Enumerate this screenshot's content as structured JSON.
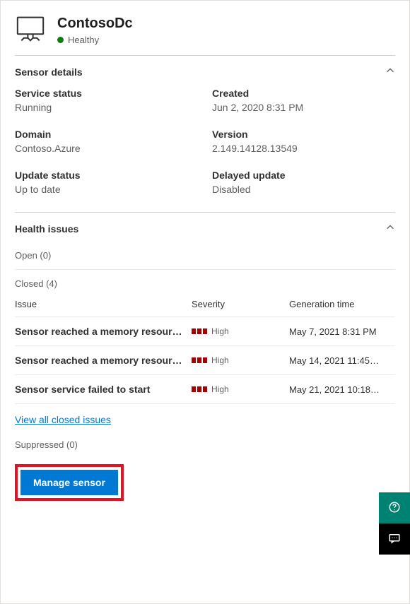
{
  "header": {
    "title": "ContosoDc",
    "status_text": "Healthy",
    "status_color": "#107c10"
  },
  "sections": {
    "sensor_details": {
      "title": "Sensor details",
      "fields": {
        "service_status": {
          "label": "Service status",
          "value": "Running"
        },
        "created": {
          "label": "Created",
          "value": "Jun 2, 2020 8:31 PM"
        },
        "domain": {
          "label": "Domain",
          "value": "Contoso.Azure"
        },
        "version": {
          "label": "Version",
          "value": "2.149.14128.13549"
        },
        "update_status": {
          "label": "Update status",
          "value": "Up to date"
        },
        "delayed_update": {
          "label": "Delayed update",
          "value": "Disabled"
        }
      }
    },
    "health_issues": {
      "title": "Health issues",
      "open_label": "Open (0)",
      "closed_label": "Closed (4)",
      "columns": {
        "issue": "Issue",
        "severity": "Severity",
        "generation_time": "Generation time"
      },
      "closed_rows": [
        {
          "issue": "Sensor reached a memory resource limit",
          "severity": "High",
          "time": "May 7, 2021 8:31 PM"
        },
        {
          "issue": "Sensor reached a memory resource limit",
          "severity": "High",
          "time": "May 14, 2021 11:45…"
        },
        {
          "issue": "Sensor service failed to start",
          "severity": "High",
          "time": "May 21, 2021 10:18…"
        }
      ],
      "view_all_label": "View all closed issues",
      "suppressed_label": "Suppressed (0)"
    }
  },
  "actions": {
    "manage_sensor_label": "Manage sensor"
  }
}
